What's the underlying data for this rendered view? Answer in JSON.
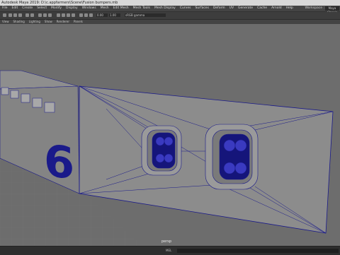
{
  "window": {
    "title": "Autodesk Maya 2019: D:\\c.appfarmers\\Scene\\Fusion bumpers.mb"
  },
  "menu": {
    "items": [
      "File",
      "Edit",
      "Create",
      "Select",
      "Modify",
      "Display",
      "Windows",
      "Mesh",
      "Edit Mesh",
      "Mesh Tools",
      "Mesh Display",
      "Curves",
      "Surfaces",
      "Deform",
      "UV",
      "Generate",
      "Cache",
      "Arnold",
      "Help"
    ],
    "workspace_label": "Workspace :",
    "workspace_value": "Maya Classic"
  },
  "toolbar": {
    "field_a": "0.00",
    "field_b": "1.00",
    "colorspace": "sRGB gamma"
  },
  "viewport_menu": {
    "items": [
      "View",
      "Shading",
      "Lighting",
      "Show",
      "Renderer",
      "Panels"
    ]
  },
  "viewport": {
    "camera_label": "persp",
    "background_color": "#6d6d6d",
    "mesh_color": "#8a8a8a",
    "wire_color": "#1a1a8a"
  },
  "statusbar": {
    "mode": "MEL"
  }
}
